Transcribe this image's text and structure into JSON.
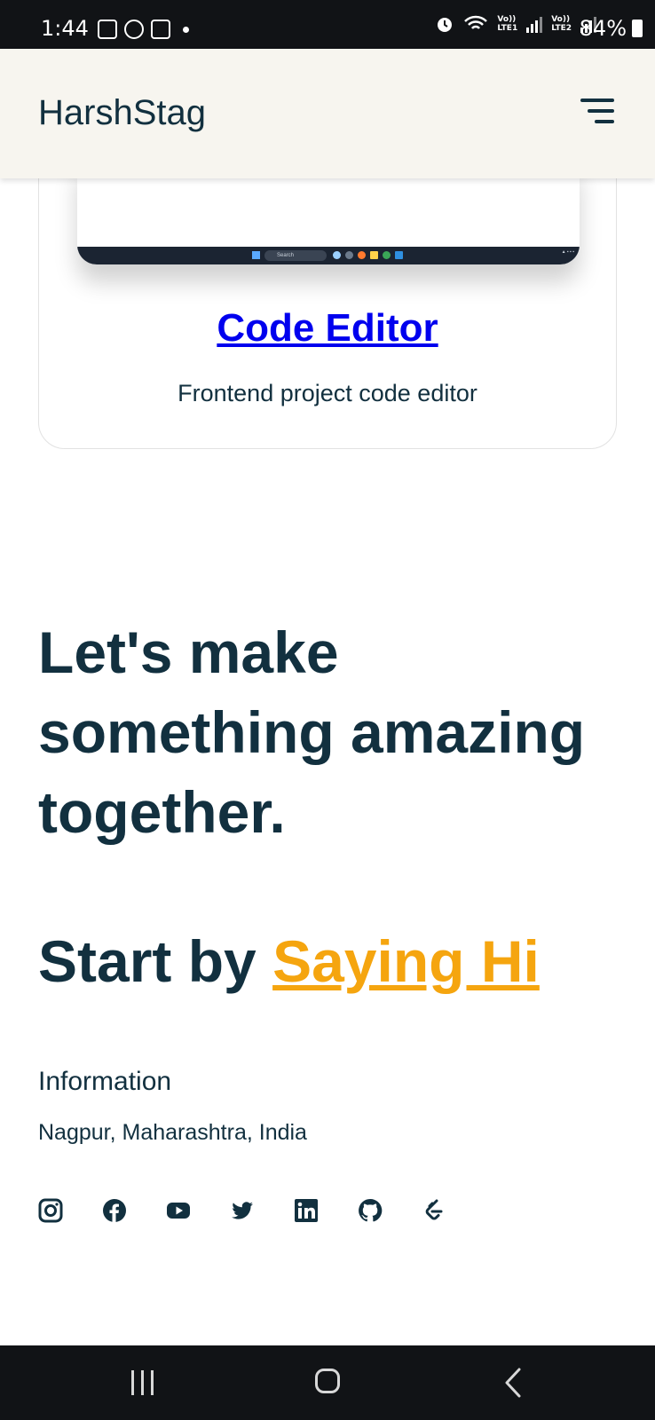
{
  "status_bar": {
    "time": "1:44",
    "battery": "84%",
    "sim1": [
      "Vo))",
      "LTE1"
    ],
    "sim2": [
      "Vo))",
      "LTE2"
    ],
    "icons": [
      "gallery-icon",
      "whatsapp-icon",
      "calculator-icon",
      "alarm-icon",
      "wifi-icon",
      "signal-icon",
      "battery-icon"
    ]
  },
  "header": {
    "brand": "HarshStag",
    "menu_icon": "menu-icon"
  },
  "project": {
    "title": "Code Editor",
    "description": "Frontend project code editor",
    "taskbar_search": "Search"
  },
  "cta": {
    "heading": "Let's make something amazing together.",
    "sub_prefix": "Start by ",
    "sub_link": "Saying Hi"
  },
  "info": {
    "title": "Information",
    "location": "Nagpur, Maharashtra, India"
  },
  "social": [
    "instagram-icon",
    "facebook-icon",
    "youtube-icon",
    "twitter-icon",
    "linkedin-icon",
    "github-icon",
    "leetcode-icon"
  ],
  "colors": {
    "text": "#12303f",
    "accent": "#f5a50f",
    "link": "#0000ee",
    "header_bg": "#f7f5ef"
  }
}
